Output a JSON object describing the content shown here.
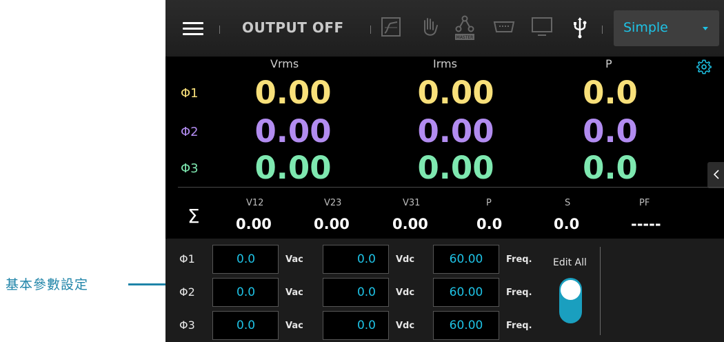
{
  "annotation": {
    "text": "基本參數設定"
  },
  "topbar": {
    "output_status": "OUTPUT OFF",
    "icons": [
      "menu-icon",
      "waveform-icon",
      "hand-icon",
      "master-icon",
      "remote-port-icon",
      "monitor-icon",
      "usb-icon"
    ],
    "master_badge": "MASTER",
    "mode": {
      "selected": "Simple"
    }
  },
  "measure": {
    "headers": {
      "vrms": "Vrms",
      "irms": "Irms",
      "p": "P"
    },
    "phases": [
      {
        "label": "Φ1",
        "vrms": "0.00",
        "irms": "0.00",
        "p": "0.0",
        "color": "#f8e07a"
      },
      {
        "label": "Φ2",
        "vrms": "0.00",
        "irms": "0.00",
        "p": "0.0",
        "color": "#b28cf0"
      },
      {
        "label": "Φ3",
        "vrms": "0.00",
        "irms": "0.00",
        "p": "0.0",
        "color": "#7ee8b0"
      }
    ]
  },
  "summary": {
    "symbol": "Σ",
    "items": [
      {
        "label": "V12",
        "value": "0.00"
      },
      {
        "label": "V23",
        "value": "0.00"
      },
      {
        "label": "V31",
        "value": "0.00"
      },
      {
        "label": "P",
        "value": "0.0"
      },
      {
        "label": "S",
        "value": "0.0"
      },
      {
        "label": "PF",
        "value": "-----"
      }
    ]
  },
  "settings": {
    "rows": [
      {
        "phase": "Φ1",
        "vac": "0.0",
        "vac_unit": "Vac",
        "vdc": "0.0",
        "vdc_unit": "Vdc",
        "freq": "60.00",
        "freq_unit": "Freq."
      },
      {
        "phase": "Φ2",
        "vac": "0.0",
        "vac_unit": "Vac",
        "vdc": "0.0",
        "vdc_unit": "Vdc",
        "freq": "60.00",
        "freq_unit": "Freq."
      },
      {
        "phase": "Φ3",
        "vac": "0.0",
        "vac_unit": "Vac",
        "vdc": "0.0",
        "vdc_unit": "Vdc",
        "freq": "60.00",
        "freq_unit": "Freq."
      }
    ],
    "edit_all_label": "Edit All",
    "edit_all_on": true
  },
  "colors": {
    "accent": "#1ec3e6",
    "toggle": "#1a9fbf",
    "annotation": "#1f84a8"
  }
}
